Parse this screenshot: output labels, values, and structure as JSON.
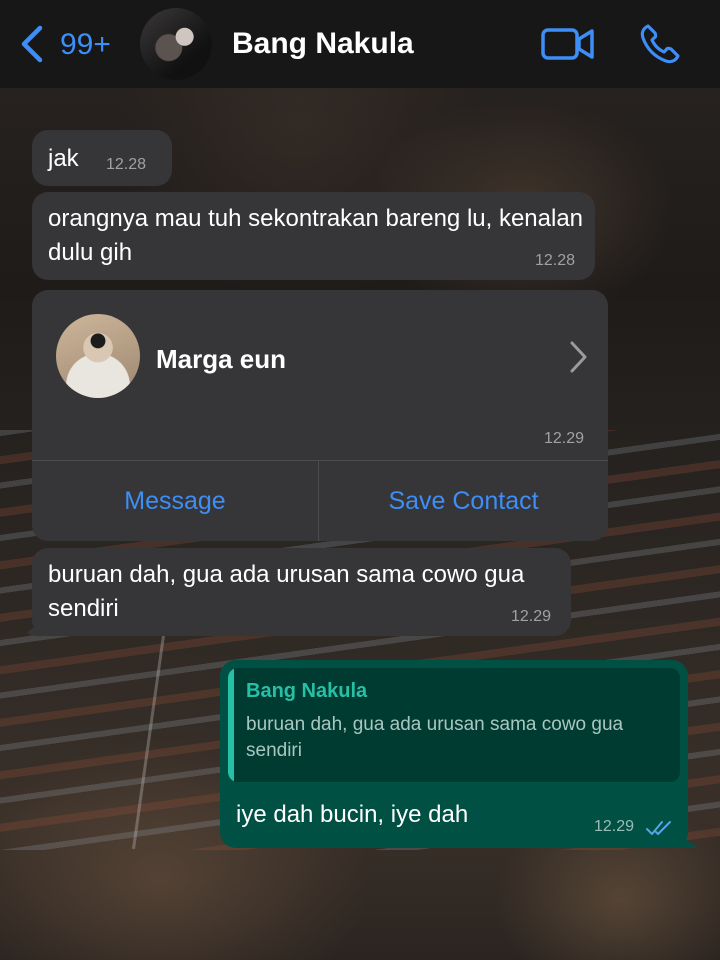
{
  "header": {
    "unread_count": "99+",
    "contact_name": "Bang Nakula"
  },
  "messages": [
    {
      "text": "jak",
      "time": "12.28"
    },
    {
      "text": "orangnya mau tuh sekontrakan bareng lu, kenalan dulu gih",
      "time": "12.28"
    },
    {
      "contact_card": {
        "name": "Marga eun",
        "time": "12.29",
        "message_label": "Message",
        "save_label": "Save Contact"
      }
    },
    {
      "text": "buruan dah, gua ada urusan sama cowo gua sendiri",
      "time": "12.29"
    }
  ],
  "outgoing": {
    "quote_author": "Bang Nakula",
    "quote_text": "buruan dah, gua ada urusan sama cowo gua sendiri",
    "text": "iye dah bucin, iye dah",
    "time": "12.29",
    "status_icon": "double-check-icon"
  },
  "colors": {
    "accent": "#3d8ef7",
    "incoming_bubble": "#363638",
    "outgoing_bubble": "#005144",
    "quote_accent": "#25c1a6"
  }
}
